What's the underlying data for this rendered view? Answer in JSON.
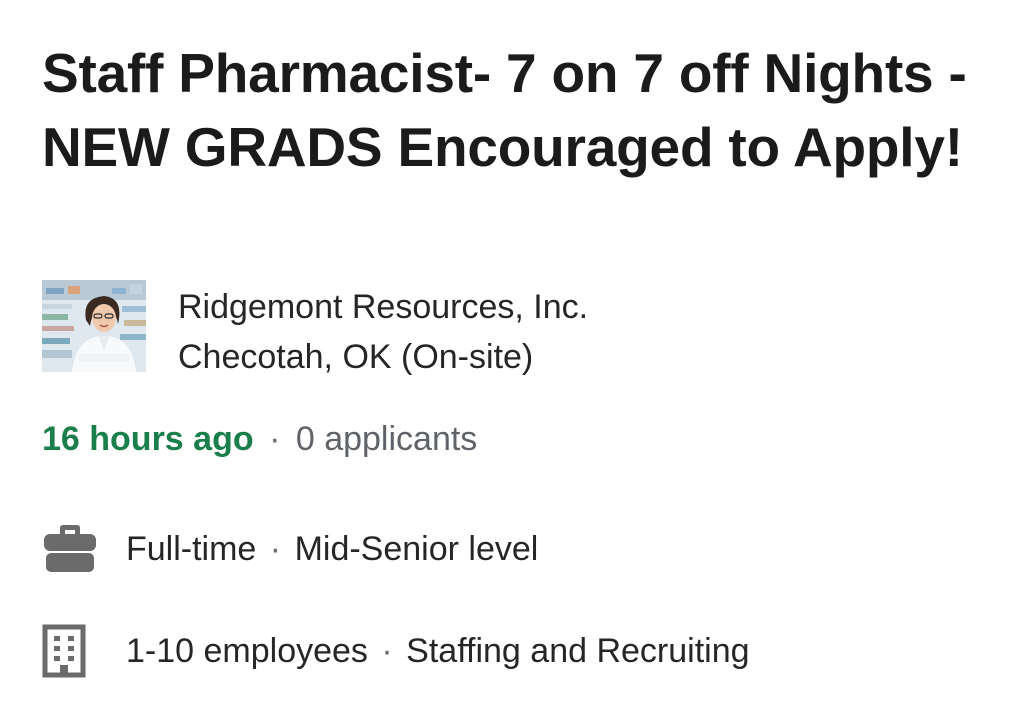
{
  "job": {
    "title": "Staff Pharmacist- 7 on 7 off Nights - NEW GRADS Encouraged to Apply!"
  },
  "company": {
    "name": "Ridgemont Resources, Inc.",
    "location": "Checotah, OK (On-site)",
    "logo_icon": "pharmacist-photo"
  },
  "meta": {
    "posted": "16 hours ago",
    "separator": "·",
    "applicants": "0 applicants"
  },
  "insights": {
    "employment": {
      "icon": "briefcase-icon",
      "type": "Full-time",
      "separator": "·",
      "level": "Mid-Senior level"
    },
    "company_size": {
      "icon": "building-icon",
      "size": "1-10 employees",
      "separator": "·",
      "industry": "Staffing and Recruiting"
    }
  },
  "colors": {
    "posted_time": "#1a7f4b",
    "applicants": "#5f6368",
    "icon_gray": "#6b6b6b"
  }
}
